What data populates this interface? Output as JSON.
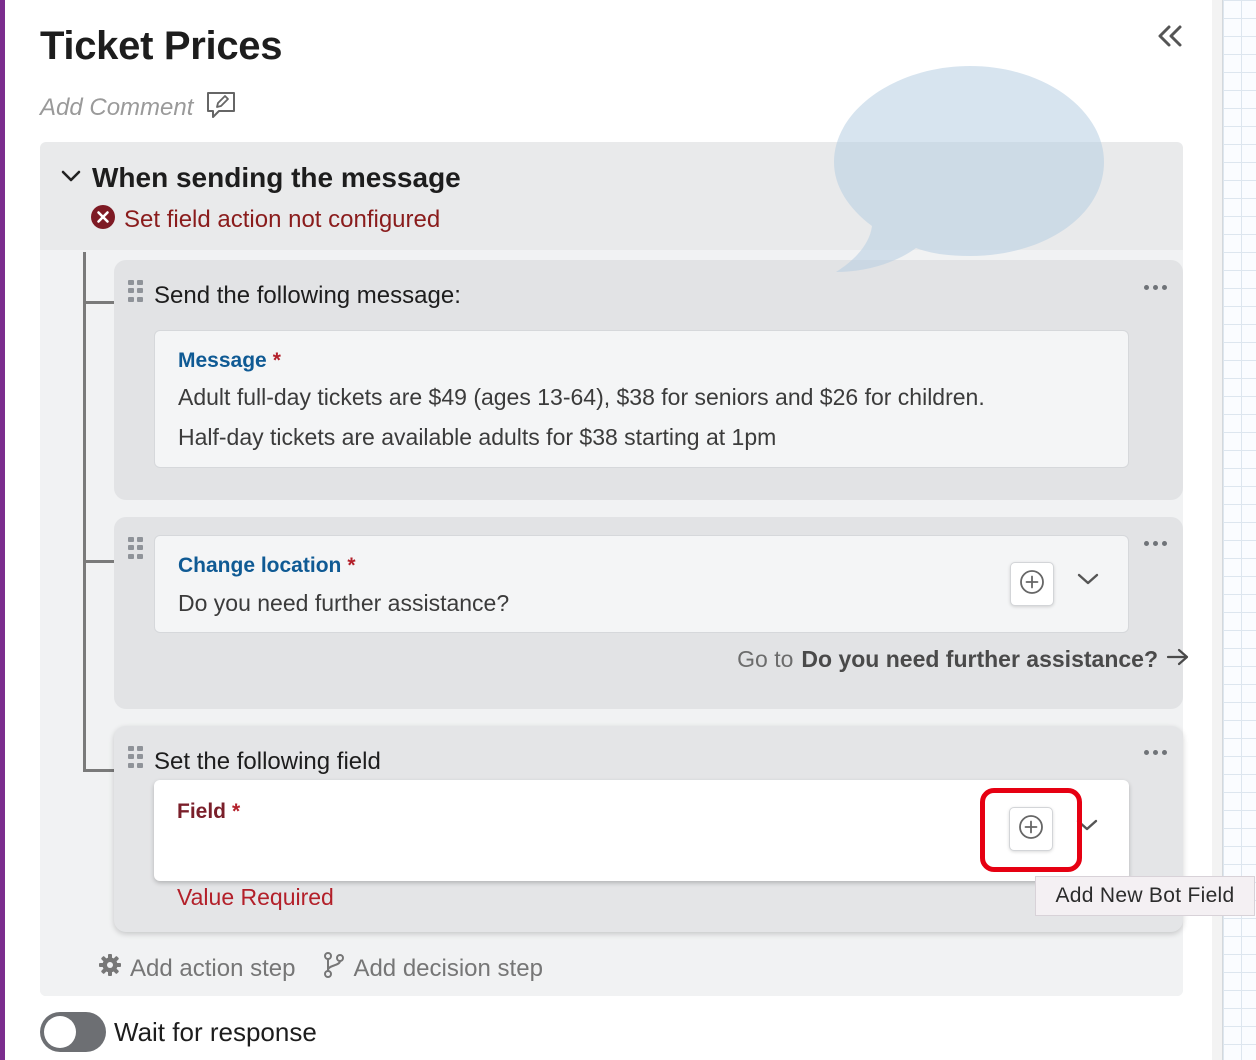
{
  "page": {
    "title": "Ticket Prices",
    "add_comment": "Add Comment"
  },
  "trigger": {
    "title": "When sending the message",
    "error": "Set field action not configured"
  },
  "steps": [
    {
      "title": "Send the following message:",
      "field_label": "Message",
      "required_mark": "*",
      "lines": [
        "Adult full-day tickets are $49 (ages 13-64), $38 for seniors and $26 for children.",
        "Half-day tickets are available adults for $38 starting at 1pm"
      ]
    },
    {
      "field_label": "Change location",
      "required_mark": "*",
      "value": "Do you need further assistance?",
      "goto_prefix": "Go to",
      "goto_target": "Do you need further assistance?"
    },
    {
      "title": "Set the following field",
      "field_label": "Field",
      "required_mark": "*",
      "validation": "Value Required"
    }
  ],
  "tooltip": "Add New Bot Field",
  "actions": {
    "add_action_step": "Add action step",
    "add_decision_step": "Add decision step"
  },
  "wait_for_response": {
    "label": "Wait for response",
    "enabled": false
  },
  "colors": {
    "accent_blue": "#0f5a94",
    "error_red": "#b3202a",
    "highlight": "#e60012"
  }
}
